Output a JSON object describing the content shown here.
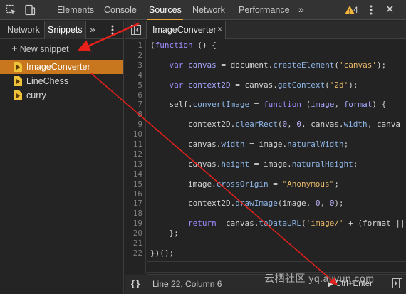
{
  "toolbar": {
    "tabs": [
      "Elements",
      "Console",
      "Sources",
      "Network",
      "Performance"
    ],
    "more_tabs_label": "»",
    "warning_count": "4",
    "close_label": "✕"
  },
  "navigator": {
    "tabs": [
      "Network",
      "Snippets"
    ],
    "more_label": "»",
    "new_snippet_label": "New snippet",
    "snippets": [
      "ImageConverter",
      "LineChess",
      "curry"
    ]
  },
  "editor": {
    "file_tab": "ImageConverter",
    "close_label": "×",
    "lines": [
      {
        "n": "1",
        "html": "(<span class='kw'>function</span> () {"
      },
      {
        "n": "2",
        "html": ""
      },
      {
        "n": "3",
        "html": "    <span class='kw'>var</span> <span class='var'>canvas</span> = document.<span class='prop'>createElement</span>(<span class='str'>'canvas'</span>);"
      },
      {
        "n": "4",
        "html": ""
      },
      {
        "n": "5",
        "html": "    <span class='kw'>var</span> <span class='var'>context2D</span> = canvas.<span class='prop'>getContext</span>(<span class='str'>'2d'</span>);"
      },
      {
        "n": "6",
        "html": ""
      },
      {
        "n": "7",
        "html": "    self.<span class='prop'>convertImage</span> = <span class='kw'>function</span> (<span class='var'>image</span>, <span class='var'>format</span>) {"
      },
      {
        "n": "8",
        "html": ""
      },
      {
        "n": "9",
        "html": "        context2D.<span class='prop'>clearRect</span>(<span class='num'>0</span>, <span class='num'>0</span>, canvas.<span class='prop'>width</span>, canva"
      },
      {
        "n": "10",
        "html": ""
      },
      {
        "n": "11",
        "html": "        canvas.<span class='prop'>width</span> = image.<span class='prop'>naturalWidth</span>;"
      },
      {
        "n": "12",
        "html": ""
      },
      {
        "n": "13",
        "html": "        canvas.<span class='prop'>height</span> = image.<span class='prop'>naturalHeight</span>;"
      },
      {
        "n": "14",
        "html": ""
      },
      {
        "n": "15",
        "html": "        image.<span class='prop'>crossOrigin</span> = <span class='str'>\"Anonymous\"</span>;"
      },
      {
        "n": "16",
        "html": ""
      },
      {
        "n": "17",
        "html": "        context2D.<span class='prop'>drawImage</span>(image, <span class='num'>0</span>, <span class='num'>0</span>);"
      },
      {
        "n": "18",
        "html": ""
      },
      {
        "n": "19",
        "html": "        <span class='kw'>return</span>  canvas.<span class='prop'>toDataURL</span>(<span class='str'>'image/'</span> + (format ||"
      },
      {
        "n": "20",
        "html": "    };"
      },
      {
        "n": "21",
        "html": ""
      },
      {
        "n": "22",
        "html": "})();"
      }
    ]
  },
  "status": {
    "braces": "{}",
    "position": "Line 22, Column 6",
    "run_label": "Ctrl+Enter"
  },
  "watermark": "云栖社区 yq.aliyun.com",
  "colors": {
    "selected_snippet": "#c8771e",
    "active_tab_underline": "#e8a33b",
    "annotation_arrow": "#e8201c"
  }
}
